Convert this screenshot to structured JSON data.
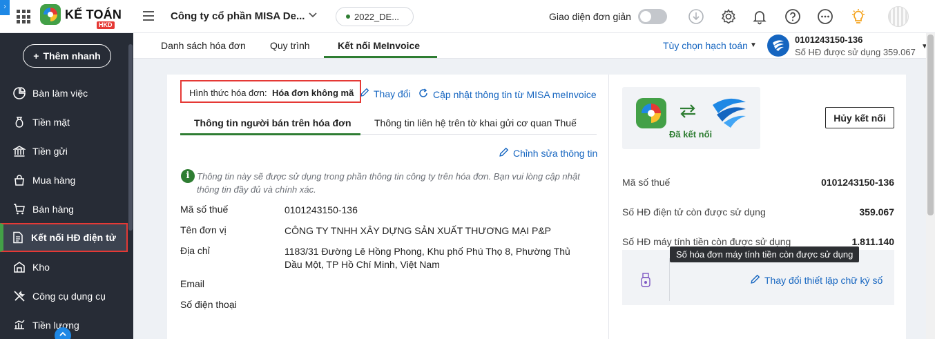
{
  "header": {
    "corner_tab": "›",
    "brand_name": "KẾ TOÁN",
    "brand_badge": "HKD",
    "company_name": "Công ty cổ phần MISA De...",
    "year": "2022_DE...",
    "simple_ui_label": "Giao diện đơn giản",
    "simple_ui_enabled": false,
    "accent_color": "#1565c0",
    "icons": [
      "apps-grid-icon",
      "hamburger-menu-icon",
      "download-icon",
      "gear-icon",
      "bell-icon",
      "help-icon",
      "more-icon",
      "lightbulb-icon",
      "avatar"
    ]
  },
  "sidebar": {
    "quick_add": "Thêm nhanh",
    "items": [
      {
        "label": "Bàn làm việc",
        "icon": "dashboard-icon"
      },
      {
        "label": "Tiền mặt",
        "icon": "cash-bag-icon"
      },
      {
        "label": "Tiền gửi",
        "icon": "bank-icon"
      },
      {
        "label": "Mua hàng",
        "icon": "shopping-bag-icon"
      },
      {
        "label": "Bán hàng",
        "icon": "cart-icon"
      },
      {
        "label": "Kết nối HĐ điện tử",
        "icon": "e-invoice-icon",
        "active": true
      },
      {
        "label": "Kho",
        "icon": "warehouse-icon"
      },
      {
        "label": "Công cụ dụng cụ",
        "icon": "tools-icon"
      },
      {
        "label": "Tiền lương",
        "icon": "salary-icon"
      }
    ],
    "active_color": "#43a047",
    "highlight_color": "#e53935"
  },
  "tabs": {
    "items": [
      "Danh sách hóa đơn",
      "Quy trình",
      "Kết nối MeInvoice"
    ],
    "active_index": 2,
    "options_link": "Tùy chọn hạch toán"
  },
  "account": {
    "tax_code": "0101243150-136",
    "used_label": "Số HĐ được sử dụng 359.067"
  },
  "invoice_type": {
    "label": "Hình thức hóa đơn:",
    "value": "Hóa đơn không mã",
    "change_link": "Thay đổi",
    "update_link": "Cập nhật thông tin từ MISA meInvoice"
  },
  "subtabs": {
    "items": [
      "Thông tin người bán trên hóa đơn",
      "Thông tin liên hệ trên tờ khai gửi cơ quan Thuế"
    ],
    "active_index": 0,
    "edit_link": "Chỉnh sửa thông tin"
  },
  "info_note": "Thông tin này sẽ được sử dụng trong phần thông tin công ty trên hóa đơn. Bạn vui lòng cập nhật thông tin đầy đủ và chính xác.",
  "seller": {
    "fields": [
      {
        "label": "Mã số thuế",
        "value": "0101243150-136"
      },
      {
        "label": "Tên đơn vị",
        "value": "CÔNG TY TNHH XÂY DỰNG SẢN XUẤT THƯƠNG MẠI P&P"
      },
      {
        "label": "Địa chỉ",
        "value": "1183/31 Đường Lê Hồng Phong, Khu phố Phú Thọ 8, Phường Thủ Dầu Một, TP Hồ Chí Minh, Việt Nam"
      },
      {
        "label": "Email",
        "value": ""
      },
      {
        "label": "Số điện thoại",
        "value": ""
      }
    ]
  },
  "connection": {
    "status": "Đã kết nối",
    "disconnect_button": "Hủy kết nối",
    "status_color": "#2e7d32"
  },
  "stats": [
    {
      "label": "Mã số thuế",
      "value": "0101243150-136"
    },
    {
      "label": "Số HĐ điện tử còn được sử dụng",
      "value": "359.067"
    },
    {
      "label": "Số HĐ máy tính tiền còn được sử dụng",
      "value": "1.811.140"
    }
  ],
  "signature": {
    "change_link": "Thay đổi thiết lập chữ ký số"
  },
  "tooltip": "Số hóa đơn máy tính tiền còn được sử dụng"
}
